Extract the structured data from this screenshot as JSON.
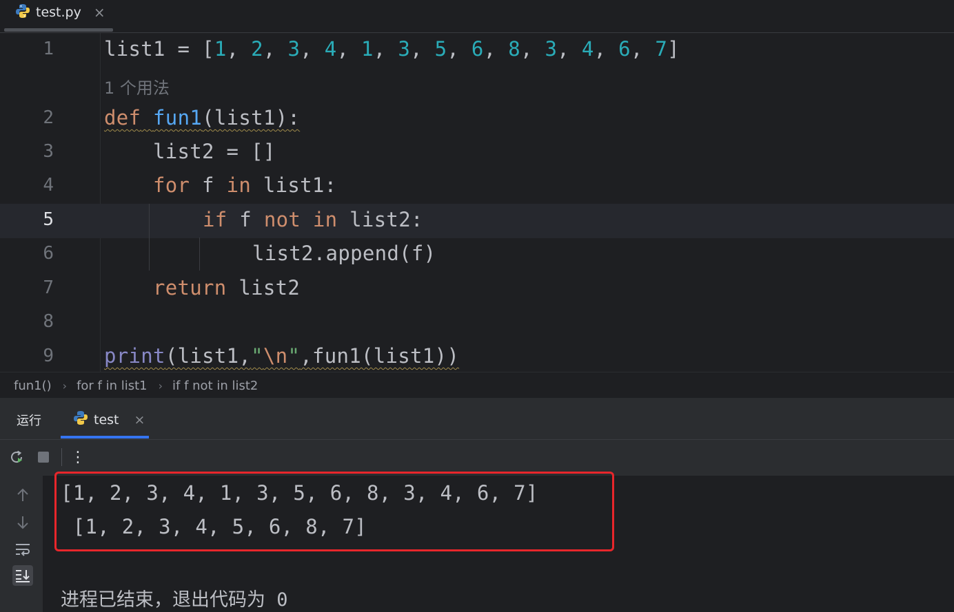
{
  "editor_tab": {
    "filename": "test.py",
    "icon": "python-icon",
    "close": "×"
  },
  "code_lines": {
    "l1": {
      "num": "1",
      "t1": "list1 = [",
      "n1": "1",
      "n2": "2",
      "n3": "3",
      "n4": "4",
      "n5": "1",
      "n6": "3",
      "n7": "5",
      "n8": "6",
      "n9": "8",
      "n10": "3",
      "n11": "4",
      "n12": "6",
      "n13": "7",
      "sep": ", ",
      "end": "]"
    },
    "usage_hint": "1 个用法",
    "l2": {
      "num": "2",
      "kw": "def",
      "fn": "fun1",
      "rest": "(list1):"
    },
    "l3": {
      "num": "3",
      "text": "list2 = []"
    },
    "l4": {
      "num": "4",
      "kw1": "for",
      "a": " f ",
      "kw2": "in",
      "b": " list1:"
    },
    "l5": {
      "num": "5",
      "kw1": "if",
      "a": " f ",
      "kw2": "not",
      "kw3": "in",
      "b": " list2:"
    },
    "l6": {
      "num": "6",
      "text": "list2.append(f)"
    },
    "l7": {
      "num": "7",
      "kw": "return",
      "b": " list2"
    },
    "l8": {
      "num": "8"
    },
    "l9": {
      "num": "9",
      "bi": "print",
      "a": "(list1,",
      "q1": "\"",
      "esc": "\\n",
      "q2": "\"",
      "b": ",fun1(list1))"
    }
  },
  "breadcrumb": {
    "items": [
      "fun1()",
      "for f in list1",
      "if f not in list2"
    ],
    "sep": "›"
  },
  "run_panel": {
    "title": "运行",
    "tab_label": "test",
    "tab_close": "×",
    "toolbar": [
      "rerun-icon",
      "stop-icon",
      "more-icon"
    ],
    "more_glyph": "⋮",
    "side_tools": [
      "up-arrow-icon",
      "down-arrow-icon",
      "soft-wrap-icon",
      "scroll-to-end-icon"
    ]
  },
  "console_output": {
    "line1": "[1, 2, 3, 4, 1, 3, 5, 6, 8, 3, 4, 6, 7]",
    "line2": " [1, 2, 3, 4, 5, 6, 8, 7]",
    "exit_message": "进程已结束，退出代码为 0"
  },
  "colors": {
    "highlight_box": "#e8262b",
    "accent_tab": "#3574f0"
  }
}
